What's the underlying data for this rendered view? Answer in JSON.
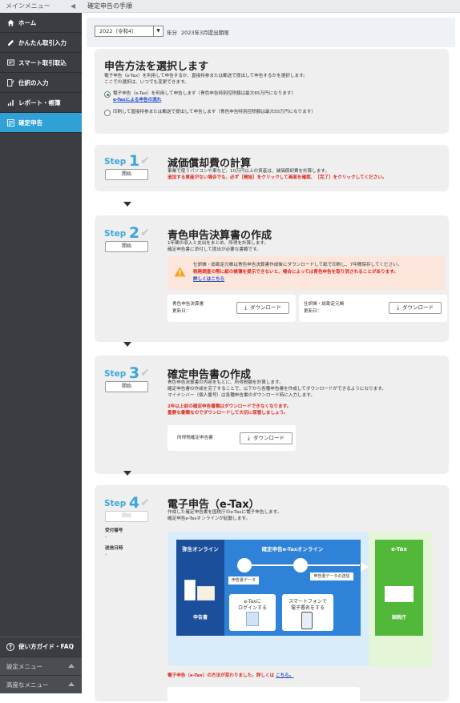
{
  "sidebar": {
    "header": "メインメニュー",
    "items": [
      {
        "icon": "home-icon",
        "label": "ホーム"
      },
      {
        "icon": "pencil-icon",
        "label": "かんたん取引入力"
      },
      {
        "icon": "import-icon",
        "label": "スマート取引取込"
      },
      {
        "icon": "journal-icon",
        "label": "仕訳の入力"
      },
      {
        "icon": "report-chart-icon",
        "label": "レポート・帳簿"
      },
      {
        "icon": "tax-return-icon",
        "label": "確定申告"
      }
    ],
    "guide_label": "使い方ガイド・FAQ",
    "settings_menu": "設定メニュー",
    "advanced_menu": "高度なメニュー"
  },
  "topbar": {
    "title": "確定申告の手順"
  },
  "year": {
    "selected": "2022（令和4）",
    "suffix": "年分",
    "note": "2023年3月提出期限"
  },
  "method": {
    "title": "申告方法を選択します",
    "desc1": "電子申告（e-Tax）を利用して申告するか、直接持参または郵送で提出して申告するかを選択します。",
    "desc2": "ここでの選択は、いつでも変更できます。",
    "option_etax": "電子申告（e-Tax）を利用して申告します（青色申告特別控除額は最大65万円になります）",
    "option_etax_link": "e-Taxによる申告の流れ",
    "option_paper": "印刷して直接持参または郵送で提出して申告します（青色申告特別控除額は最大55万円になります）"
  },
  "steps": {
    "prefix": "Step",
    "start_label": "開始",
    "step1": {
      "num": "1",
      "title": "減価償却費の計算",
      "desc": "事業で使うパソコンや車など、10万円以上の資産は、減価償却費を計算します。",
      "red": "追加する資産がない場合でも、必ず［開始］をクリックして画面を確認、［完了］をクリックしてください。"
    },
    "step2": {
      "num": "2",
      "title": "青色申告決算書の作成",
      "desc1": "1年間の収入と支出をまとめ、所得を計算します。",
      "desc2": "確定申告書に添付して提出が必要な書類です。",
      "warn1": "仕訳帳・総勘定元帳は青色申告決算書作成後にダウンロードして紙で印刷し、7年間保存してください。",
      "warn2": "税務調査の際に紙の帳簿を提示できないと、場合によっては青色申告を取り消されることがあります。",
      "warn_link": "詳しくはこちら",
      "dl1_label": "青色申告決算書",
      "dl1_updated": "更新日：",
      "dl2_label": "仕訳帳・総勘定元帳",
      "dl2_updated": "更新日："
    },
    "step3": {
      "num": "3",
      "title": "確定申告書の作成",
      "desc1": "青色申告決算書の内容をもとに、所得税額を計算します。",
      "desc2": "確定申告書の作成を完了することで、以下から各種申告書を作成してダウンロードができるようになります。",
      "desc3": "マイナンバー（個人番号）は各種申告書のダウンロード時に入力します。",
      "red1": "2年以上前の確定申告書類はダウンロードできなくなります。",
      "red2": "重要な書類なのでダウンロードして大切に保管しましょう。",
      "dl_label": "所得税確定申告書"
    },
    "step4": {
      "num": "4",
      "title": "電子申告（e-Tax）",
      "desc1": "作成した確定申告書を国税庁のe-Taxに電子申告します。",
      "desc2": "確定申告e-Taxオンラインが起動します。",
      "receipt_label": "受付番号",
      "receipt_value": "-",
      "sent_label": "送信日時",
      "sent_value": "-",
      "footer_red": "電子申告（e-Tax）の方法が変わりました。詳しくは",
      "footer_link": "こちら。"
    }
  },
  "download_label": "ダウンロード",
  "diagram": {
    "yayoi": "弥生オンライン",
    "etax_online": "確定申告e-Taxオンライン",
    "etax": "e-Tax",
    "doc": "申告書",
    "data": "申告書データ",
    "send": "申告書データの送信",
    "login_l1": "e-Taxに",
    "login_l2": "ログインする",
    "smartphone_l1": "スマートフォンで",
    "smartphone_l2": "電子署名をする",
    "nta": "国税庁"
  }
}
